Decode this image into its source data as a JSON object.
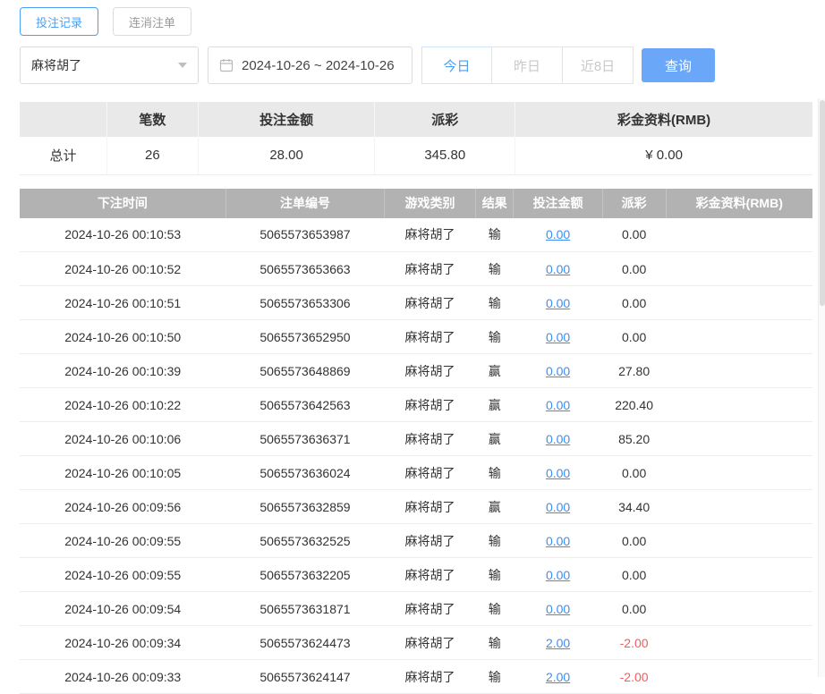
{
  "tabs": {
    "betting_records": "投注记录",
    "cancelled_orders": "连消注单"
  },
  "filters": {
    "game_select_value": "麻将胡了",
    "date_range_value": "2024-10-26 ~ 2024-10-26",
    "today_label": "今日",
    "yesterday_label": "昨日",
    "last8days_label": "近8日",
    "query_label": "查询"
  },
  "summary": {
    "headers": {
      "count": "笔数",
      "bet_amount": "投注金额",
      "payout": "派彩",
      "jackpot": "彩金资料(RMB)"
    },
    "total_label": "总计",
    "count": "26",
    "bet_amount": "28.00",
    "payout": "345.80",
    "jackpot": "¥ 0.00"
  },
  "table": {
    "headers": {
      "time": "下注时间",
      "order": "注单编号",
      "game": "游戏类别",
      "result": "结果",
      "bet": "投注金额",
      "payout": "派彩",
      "jackpot": "彩金资料(RMB)"
    },
    "rows": [
      {
        "time": "2024-10-26 00:10:53",
        "order": "5065573653987",
        "game": "麻将胡了",
        "result": "输",
        "bet": "0.00",
        "payout": "0.00",
        "jackpot": ""
      },
      {
        "time": "2024-10-26 00:10:52",
        "order": "5065573653663",
        "game": "麻将胡了",
        "result": "输",
        "bet": "0.00",
        "payout": "0.00",
        "jackpot": ""
      },
      {
        "time": "2024-10-26 00:10:51",
        "order": "5065573653306",
        "game": "麻将胡了",
        "result": "输",
        "bet": "0.00",
        "payout": "0.00",
        "jackpot": ""
      },
      {
        "time": "2024-10-26 00:10:50",
        "order": "5065573652950",
        "game": "麻将胡了",
        "result": "输",
        "bet": "0.00",
        "payout": "0.00",
        "jackpot": ""
      },
      {
        "time": "2024-10-26 00:10:39",
        "order": "5065573648869",
        "game": "麻将胡了",
        "result": "赢",
        "bet": "0.00",
        "payout": "27.80",
        "jackpot": ""
      },
      {
        "time": "2024-10-26 00:10:22",
        "order": "5065573642563",
        "game": "麻将胡了",
        "result": "赢",
        "bet": "0.00",
        "payout": "220.40",
        "jackpot": ""
      },
      {
        "time": "2024-10-26 00:10:06",
        "order": "5065573636371",
        "game": "麻将胡了",
        "result": "赢",
        "bet": "0.00",
        "payout": "85.20",
        "jackpot": ""
      },
      {
        "time": "2024-10-26 00:10:05",
        "order": "5065573636024",
        "game": "麻将胡了",
        "result": "输",
        "bet": "0.00",
        "payout": "0.00",
        "jackpot": ""
      },
      {
        "time": "2024-10-26 00:09:56",
        "order": "5065573632859",
        "game": "麻将胡了",
        "result": "赢",
        "bet": "0.00",
        "payout": "34.40",
        "jackpot": ""
      },
      {
        "time": "2024-10-26 00:09:55",
        "order": "5065573632525",
        "game": "麻将胡了",
        "result": "输",
        "bet": "0.00",
        "payout": "0.00",
        "jackpot": ""
      },
      {
        "time": "2024-10-26 00:09:55",
        "order": "5065573632205",
        "game": "麻将胡了",
        "result": "输",
        "bet": "0.00",
        "payout": "0.00",
        "jackpot": ""
      },
      {
        "time": "2024-10-26 00:09:54",
        "order": "5065573631871",
        "game": "麻将胡了",
        "result": "输",
        "bet": "0.00",
        "payout": "0.00",
        "jackpot": ""
      },
      {
        "time": "2024-10-26 00:09:34",
        "order": "5065573624473",
        "game": "麻将胡了",
        "result": "输",
        "bet": "2.00",
        "payout": "-2.00",
        "jackpot": ""
      },
      {
        "time": "2024-10-26 00:09:33",
        "order": "5065573624147",
        "game": "麻将胡了",
        "result": "输",
        "bet": "2.00",
        "payout": "-2.00",
        "jackpot": ""
      }
    ]
  },
  "colors": {
    "accent_blue": "#4a9ff5",
    "query_button_blue": "#6aa7f8",
    "link_blue": "#3d8df5",
    "negative_red": "#f35b5b",
    "table_header_gray": "#b2b2b2",
    "summary_header_gray": "#e9e9e9"
  }
}
